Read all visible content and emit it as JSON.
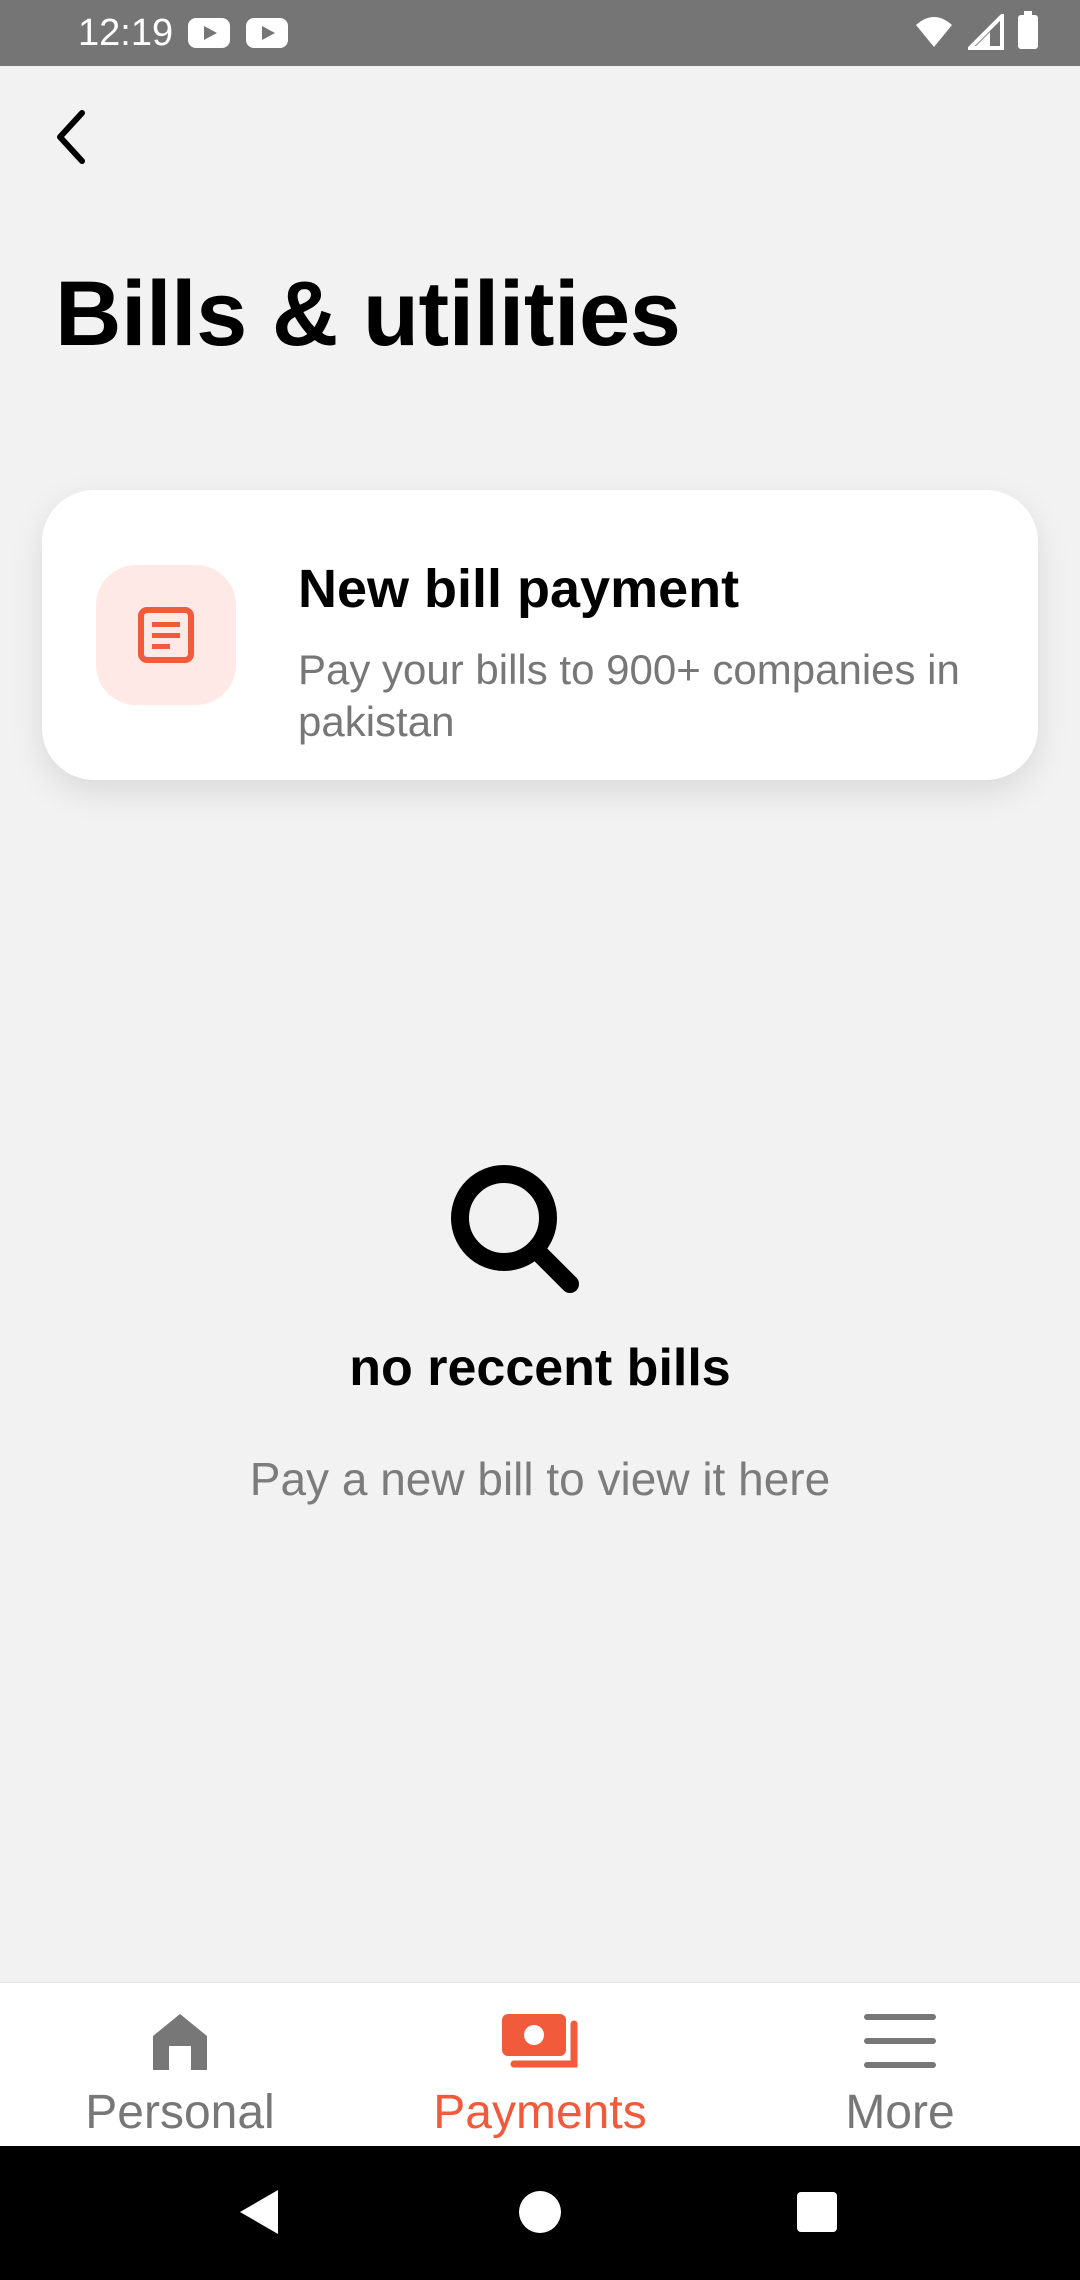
{
  "status_bar": {
    "time": "12:19",
    "left_icons": [
      "youtube-icon",
      "youtube-icon"
    ],
    "right_icons": [
      "wifi-icon",
      "signal-icon",
      "battery-icon"
    ]
  },
  "header": {
    "back_icon": "chevron-left-icon",
    "title": "Bills & utilities"
  },
  "new_bill_card": {
    "icon": "bill-document-icon",
    "title": "New bill payment",
    "subtitle": "Pay your bills to 900+ companies in pakistan"
  },
  "empty_state": {
    "icon": "search-icon",
    "title": "no reccent bills",
    "subtitle": "Pay a new bill to view it here"
  },
  "bottom_nav": {
    "items": [
      {
        "label": "Personal",
        "icon": "home-icon",
        "active": false
      },
      {
        "label": "Payments",
        "icon": "payments-icon",
        "active": true
      },
      {
        "label": "More",
        "icon": "menu-icon",
        "active": false
      }
    ]
  },
  "colors": {
    "accent": "#f25a3c",
    "accent_light": "#ffe9e6",
    "background": "#f2f2f2",
    "status_bar": "#757575",
    "muted_text": "#777777"
  }
}
